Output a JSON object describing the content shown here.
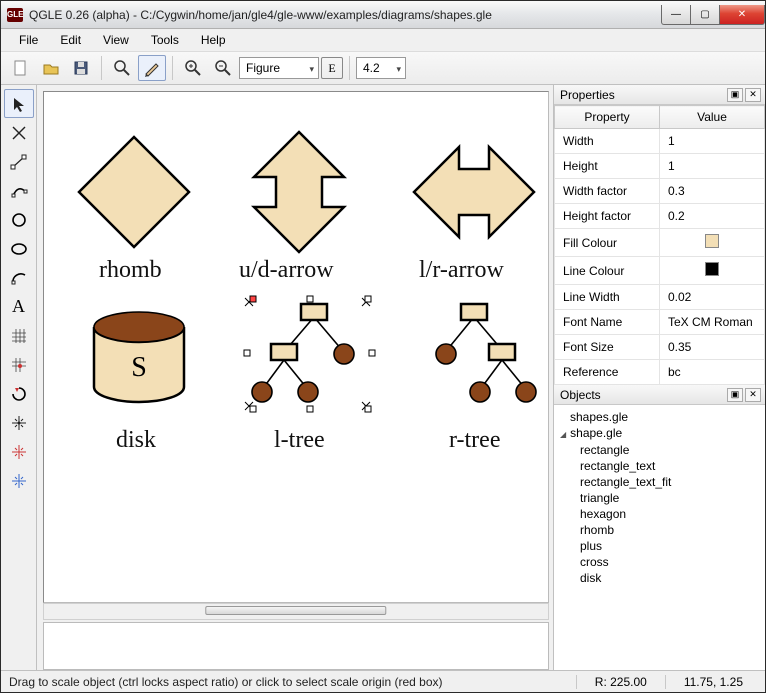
{
  "window": {
    "title": "QGLE 0.26 (alpha) - C:/Cygwin/home/jan/gle4/gle-www/examples/diagrams/shapes.gle",
    "app_badge": "GLE"
  },
  "menu": {
    "file": "File",
    "edit": "Edit",
    "view": "View",
    "tools": "Tools",
    "help": "Help"
  },
  "toolbar": {
    "figure_mode": "Figure",
    "zoom_value": "4.2"
  },
  "canvas": {
    "labels": {
      "rhomb": "rhomb",
      "udarrow": "u/d-arrow",
      "lrarrow": "l/r-arrow",
      "disk": "disk",
      "ltree": "l-tree",
      "rtree": "r-tree"
    },
    "disk_letter": "S"
  },
  "properties_panel": {
    "title": "Properties",
    "header_prop": "Property",
    "header_val": "Value",
    "rows": [
      {
        "name": "Width",
        "value": "1"
      },
      {
        "name": "Height",
        "value": "1"
      },
      {
        "name": "Width factor",
        "value": "0.3"
      },
      {
        "name": "Height factor",
        "value": "0.2"
      },
      {
        "name": "Fill Colour",
        "swatch": "#f3dfb6"
      },
      {
        "name": "Line Colour",
        "swatch": "#000000"
      },
      {
        "name": "Line Width",
        "value": "0.02"
      },
      {
        "name": "Font Name",
        "value": "TeX CM Roman"
      },
      {
        "name": "Font Size",
        "value": "0.35"
      },
      {
        "name": "Reference",
        "value": "bc"
      }
    ]
  },
  "objects_panel": {
    "title": "Objects",
    "root": "shapes.gle",
    "parent": "shape.gle",
    "children": [
      "rectangle",
      "rectangle_text",
      "rectangle_text_fit",
      "triangle",
      "hexagon",
      "rhomb",
      "plus",
      "cross",
      "disk"
    ]
  },
  "status": {
    "hint": "Drag to scale object (ctrl locks aspect ratio) or click to select scale origin (red box)",
    "r_label": "R:",
    "r_value": "225.00",
    "coords": "11.75, 1.25"
  }
}
